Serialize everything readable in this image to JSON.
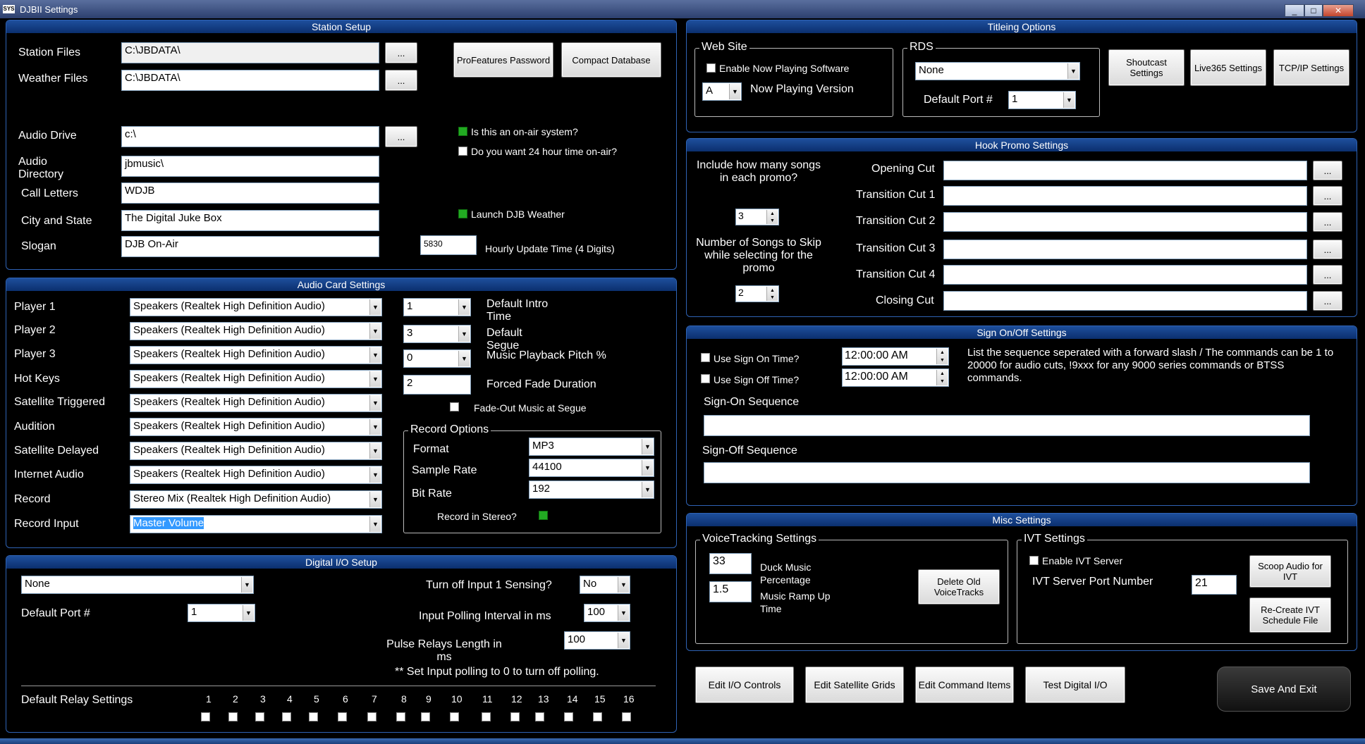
{
  "window": {
    "title": "DJBII Settings",
    "app_icon": "SYS",
    "controls": [
      "_",
      "□",
      "✕"
    ]
  },
  "station_setup": {
    "header": "Station Setup",
    "station_files_label": "Station Files",
    "station_files_value": "C:\\JBDATA\\",
    "weather_files_label": "Weather Files",
    "weather_files_value": "C:\\JBDATA\\",
    "browse": "...",
    "profeatures_button": "ProFeatures Password",
    "compact_button": "Compact Database",
    "audio_drive_label": "Audio Drive",
    "audio_drive_value": "c:\\",
    "audio_dir_label": "Audio Directory",
    "audio_dir_value": "jbmusic\\",
    "call_letters_label": "Call Letters",
    "call_letters_value": "WDJB",
    "city_label": "City and State",
    "city_value": "The Digital Juke Box",
    "slogan_label": "Slogan",
    "slogan_value": "DJB On-Air",
    "onair_label": "Is this an on-air system?",
    "onair_checked": true,
    "twentyfour_label": "Do you want 24 hour time on-air?",
    "twentyfour_checked": false,
    "launch_weather_label": "Launch DJB Weather",
    "launch_weather_checked": true,
    "hourly_value": "5830",
    "hourly_label": "Hourly Update Time (4 Digits)"
  },
  "audio_card": {
    "header": "Audio Card Settings",
    "players": [
      {
        "label": "Player 1",
        "value": "Speakers (Realtek High Definition Audio)"
      },
      {
        "label": "Player 2",
        "value": "Speakers (Realtek High Definition Audio)"
      },
      {
        "label": "Player 3",
        "value": "Speakers (Realtek High Definition Audio)"
      },
      {
        "label": "Hot Keys",
        "value": "Speakers (Realtek High Definition Audio)"
      },
      {
        "label": "Satellite Triggered",
        "value": "Speakers (Realtek High Definition Audio)"
      },
      {
        "label": "Audition",
        "value": "Speakers (Realtek High Definition Audio)"
      },
      {
        "label": "Satellite Delayed",
        "value": "Speakers (Realtek High Definition Audio)"
      },
      {
        "label": "Internet Audio",
        "value": "Speakers (Realtek High Definition Audio)"
      },
      {
        "label": "Record",
        "value": "Stereo Mix (Realtek High Definition Audio)"
      },
      {
        "label": "Record Input",
        "value": "Master Volume"
      }
    ],
    "intro_value": "1",
    "intro_label": "Default Intro Time",
    "segue_value": "3",
    "segue_label": "Default Segue",
    "pitch_value": "0",
    "pitch_label": "Music Playback Pitch %",
    "fade_value": "2",
    "fade_label": "Forced Fade Duration",
    "fadeout_label": "Fade-Out Music at Segue",
    "fadeout_checked": false,
    "record_options": {
      "title": "Record Options",
      "format_label": "Format",
      "format_value": "MP3",
      "rate_label": "Sample Rate",
      "rate_value": "44100",
      "bitrate_label": "Bit Rate",
      "bitrate_value": "192",
      "stereo_label": "Record in Stereo?",
      "stereo_checked": true
    }
  },
  "digital_io": {
    "header": "Digital I/O Setup",
    "device_value": "None",
    "port_label": "Default Port #",
    "port_value": "1",
    "turnoff_label": "Turn off Input 1 Sensing?",
    "turnoff_value": "No",
    "polling_label": "Input Polling Interval in ms",
    "polling_value": "100",
    "pulse_label": "Pulse Relays Length in ms",
    "pulse_value": "100",
    "note": "**  Set Input polling to 0 to turn off polling.",
    "relay_label": "Default Relay Settings",
    "relays": [
      "1",
      "2",
      "3",
      "4",
      "5",
      "6",
      "7",
      "8",
      "9",
      "10",
      "11",
      "12",
      "13",
      "14",
      "15",
      "16"
    ]
  },
  "titleing": {
    "header": "Titleing Options",
    "website_title": "Web Site",
    "enable_np_label": "Enable Now Playing Software",
    "enable_np_checked": false,
    "np_version_value": "A",
    "np_version_label": "Now Playing Version",
    "rds_title": "RDS",
    "rds_value": "None",
    "rds_port_label": "Default Port #",
    "rds_port_value": "1",
    "shoutcast_button": "Shoutcast Settings",
    "live365_button": "Live365 Settings",
    "tcpip_button": "TCP/IP Settings"
  },
  "hook_promo": {
    "header": "Hook Promo Settings",
    "include_label": "Include how many songs in each promo?",
    "include_value": "3",
    "skip_label": "Number of Songs to Skip while selecting for the promo",
    "skip_value": "2",
    "cuts": [
      {
        "label": "Opening Cut",
        "value": ""
      },
      {
        "label": "Transition Cut 1",
        "value": ""
      },
      {
        "label": "Transition Cut 2",
        "value": ""
      },
      {
        "label": "Transition Cut 3",
        "value": ""
      },
      {
        "label": "Transition Cut 4",
        "value": ""
      },
      {
        "label": "Closing Cut",
        "value": ""
      }
    ],
    "browse": "..."
  },
  "sign_onoff": {
    "header": "Sign On/Off Settings",
    "use_on_label": "Use Sign On Time?",
    "use_on_checked": false,
    "on_time": "12:00:00 AM",
    "use_off_label": "Use Sign Off Time?",
    "use_off_checked": false,
    "off_time": "12:00:00 AM",
    "info": "List the sequence seperated with a forward slash / The commands can be 1 to 20000 for audio cuts, !9xxx for any 9000 series commands or BTSS commands.",
    "signon_label": "Sign-On Sequence",
    "signon_value": "",
    "signoff_label": "Sign-Off Sequence",
    "signoff_value": ""
  },
  "misc": {
    "header": "Misc Settings",
    "vt_title": "VoiceTracking Settings",
    "duck_value": "33",
    "duck_label": "Duck Music Percentage",
    "ramp_value": "1.5",
    "ramp_label": "Music Ramp Up Time",
    "delete_vt_button": "Delete Old VoiceTracks",
    "ivt_title": "IVT Settings",
    "enable_ivt_label": "Enable IVT Server",
    "enable_ivt_checked": false,
    "ivt_port_label": "IVT Server Port Number",
    "ivt_port_value": "21",
    "scoop_button": "Scoop Audio for IVT",
    "recreate_button": "Re-Create IVT Schedule File"
  },
  "bottom_buttons": {
    "edit_io": "Edit I/O Controls",
    "edit_sat": "Edit Satellite Grids",
    "edit_cmd": "Edit Command Items",
    "test_dio": "Test Digital I/O",
    "save_exit": "Save And Exit"
  }
}
